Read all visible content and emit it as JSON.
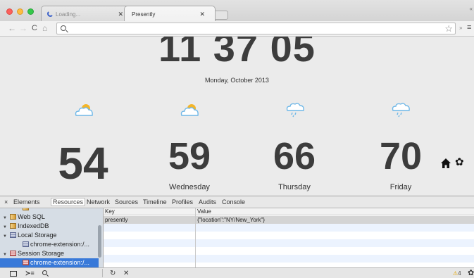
{
  "browser": {
    "tabs": [
      {
        "label": "Loading...",
        "close": "✕",
        "loading": true
      },
      {
        "label": "Presently",
        "close": "✕",
        "active": true
      }
    ],
    "window_controls": [
      "close",
      "minimize",
      "maximize"
    ],
    "corner_label": "«",
    "toolbar": {
      "back_icon": "←",
      "forward_icon": "→",
      "reload_icon": "C",
      "home_icon": "⌂",
      "omnibox_value": "",
      "star_icon": "☆",
      "extensions_label": "»",
      "menu_icon": "≡"
    }
  },
  "page": {
    "clock": "11 37 05",
    "date": "Monday, October 2013",
    "forecast": [
      {
        "icon": "partly-cloudy-icon",
        "temp": "54",
        "day": ""
      },
      {
        "icon": "partly-cloudy-icon",
        "temp": "59",
        "day": "Wednesday"
      },
      {
        "icon": "rain-icon",
        "temp": "66",
        "day": "Thursday"
      },
      {
        "icon": "rain-icon",
        "temp": "70",
        "day": "Friday"
      }
    ],
    "home_icon": "home-icon",
    "settings_icon": "✿"
  },
  "devtools": {
    "close_label": "×",
    "tabs": [
      "Elements",
      "Resources",
      "Network",
      "Sources",
      "Timeline",
      "Profiles",
      "Audits",
      "Console"
    ],
    "active_tab": "Resources",
    "sidebar": [
      {
        "label": "Web SQL",
        "expanded": true,
        "icon": "database-icon"
      },
      {
        "label": "IndexedDB",
        "expanded": true,
        "icon": "database-icon"
      },
      {
        "label": "Local Storage",
        "expanded": true,
        "icon": "local-storage-icon"
      },
      {
        "label": "chrome-extension:/...",
        "child": true,
        "icon": "local-storage-icon"
      },
      {
        "label": "Session Storage",
        "expanded": true,
        "icon": "session-storage-icon"
      },
      {
        "label": "chrome-extension:/...",
        "child": true,
        "selected": true,
        "icon": "session-storage-icon"
      }
    ],
    "table": {
      "headers": [
        "Key",
        "Value"
      ],
      "rows": [
        {
          "key": "presently",
          "value": "{\"location\":\"NY/New_York\"}"
        }
      ]
    },
    "status": {
      "console_icon": "≻≡",
      "refresh_icon": "↻",
      "clear_icon": "✕",
      "warnings": "4",
      "warning_icon": "⚠",
      "settings_icon": "✿"
    }
  },
  "colors": {
    "page_bg": "#ebebeb",
    "text_dark": "#3c3c3c",
    "sun": "#f3b52a",
    "cloud": "#6fb8e8",
    "selected_blue": "#3879d9"
  }
}
